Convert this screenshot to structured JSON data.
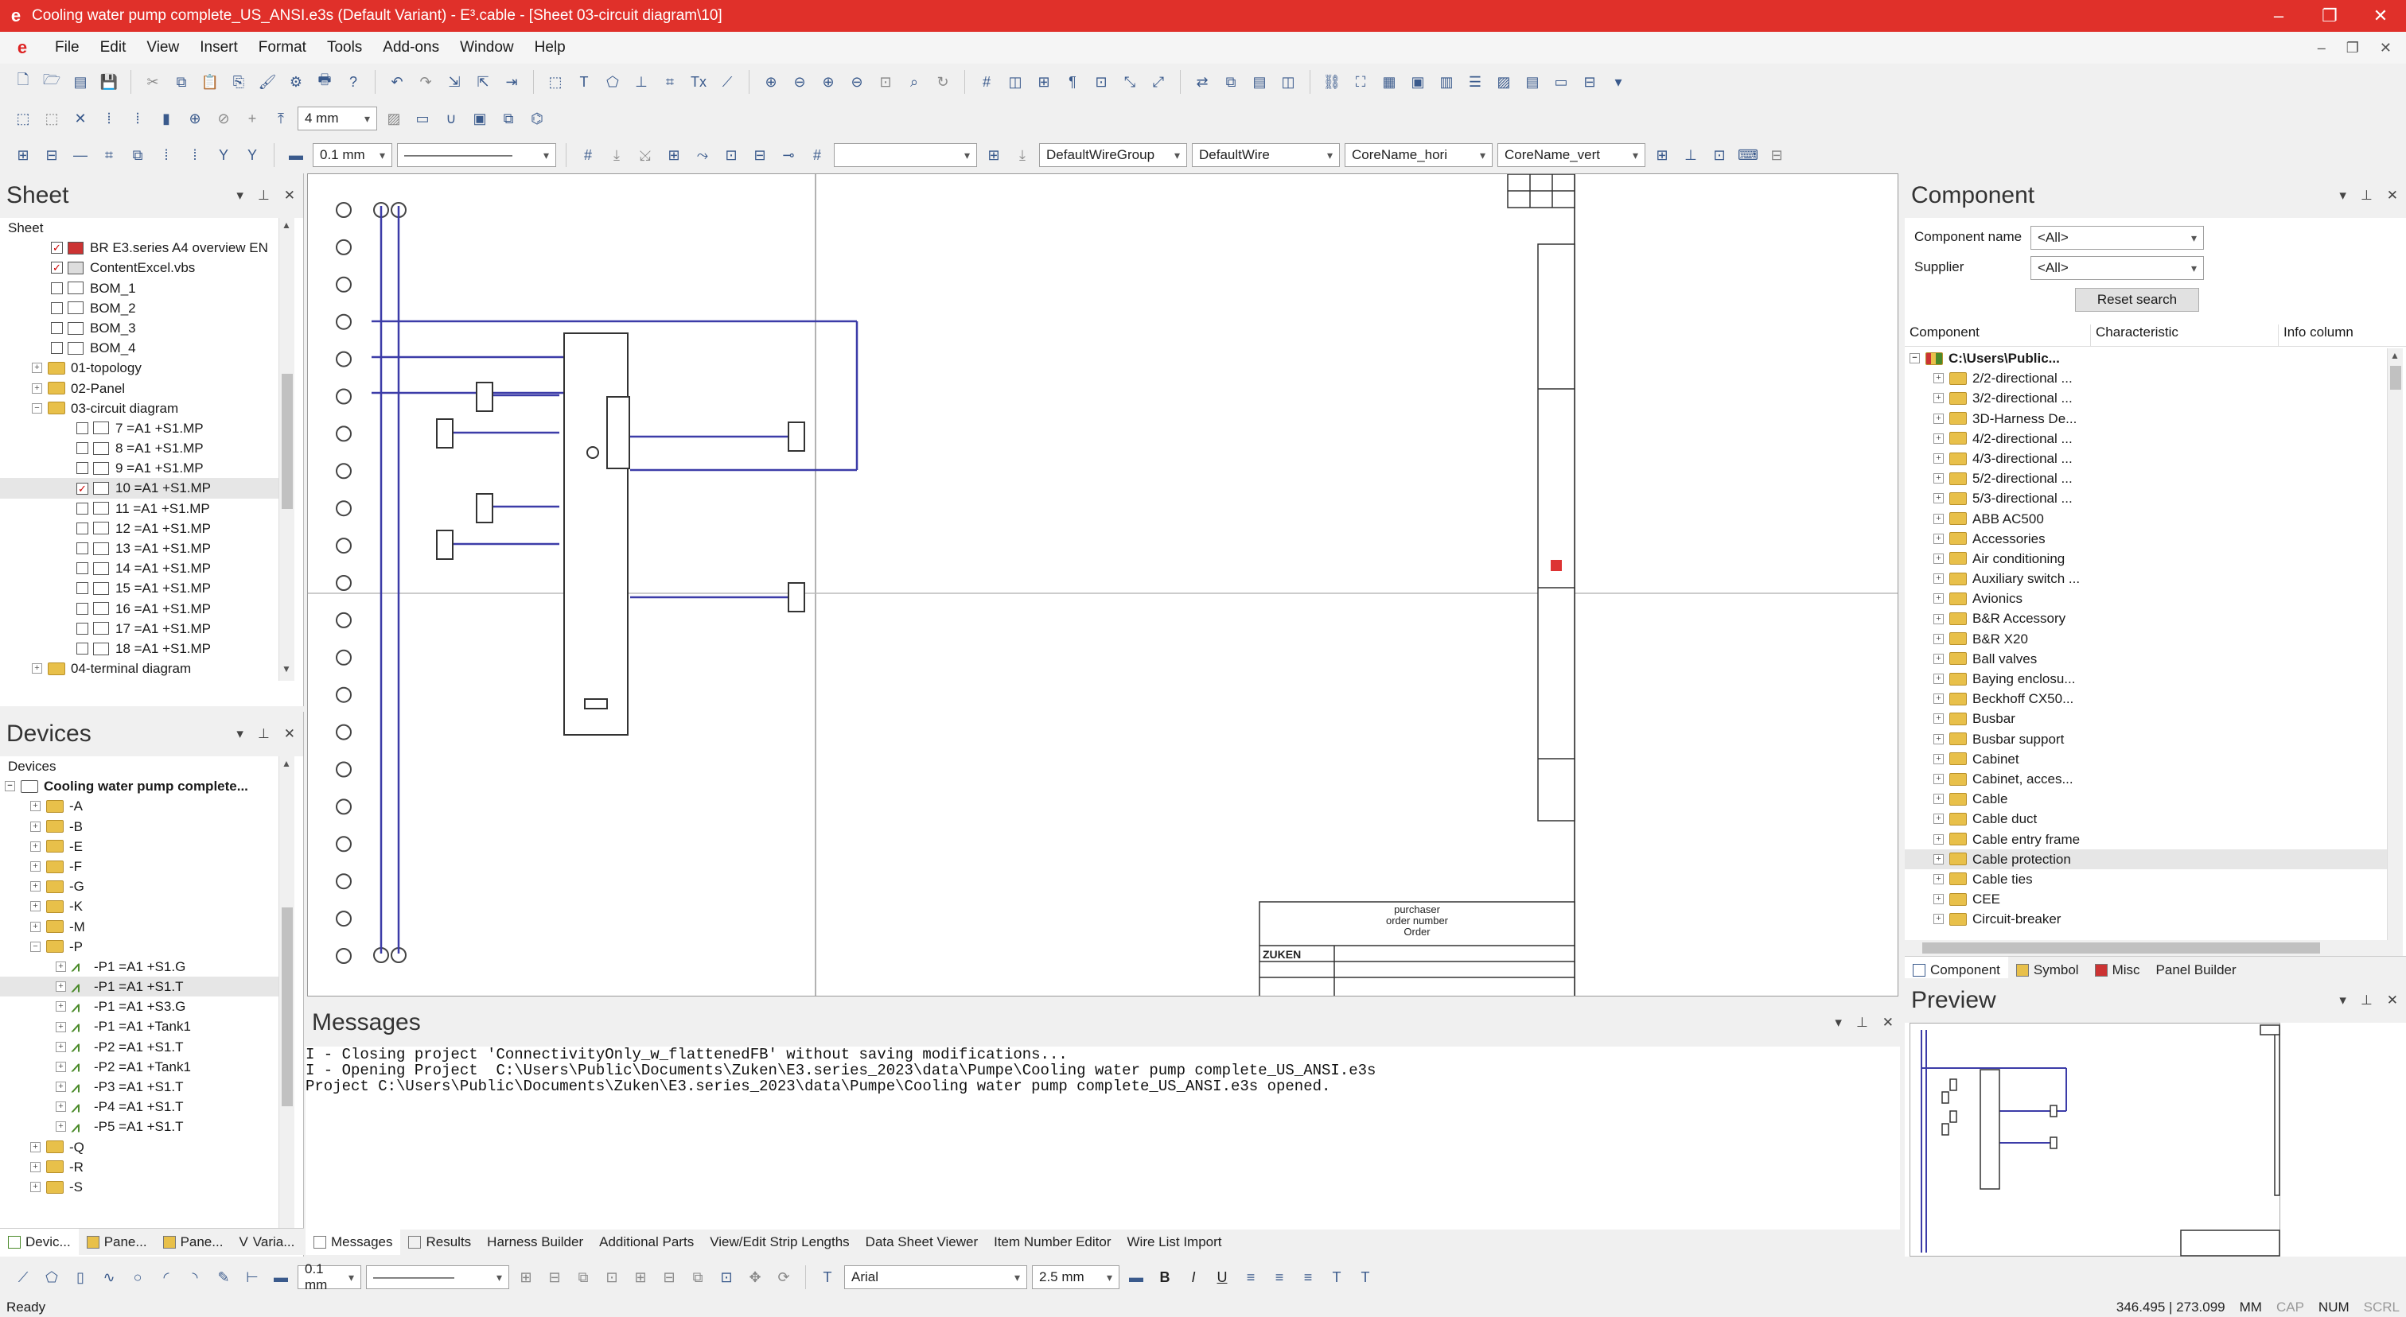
{
  "window": {
    "title": "Cooling water pump complete_US_ANSI.e3s (Default Variant) - E³.cable - [Sheet 03-circuit diagram\\10]",
    "controls": [
      "–",
      "❐",
      "✕"
    ]
  },
  "menu": [
    "File",
    "Edit",
    "View",
    "Insert",
    "Format",
    "Tools",
    "Add-ons",
    "Window",
    "Help"
  ],
  "toolbar": {
    "grid_size": "4 mm",
    "line_width": "0.1 mm",
    "wire_group": "DefaultWireGroup",
    "wire": "DefaultWire",
    "core_name_hori": "CoreName_hori",
    "core_name_vert": "CoreName_vert",
    "bottom_line_width": "0.1 mm",
    "font": "Arial",
    "font_size": "2.5 mm"
  },
  "sheet_panel": {
    "title": "Sheet",
    "header": "Sheet",
    "items": [
      {
        "label": "BR E3.series A4 overview EN",
        "kind": "pdf",
        "checked": true,
        "level": 2
      },
      {
        "label": "ContentExcel.vbs",
        "kind": "script",
        "checked": true,
        "level": 2
      },
      {
        "label": "BOM_1",
        "kind": "sheet",
        "checked": false,
        "level": 2
      },
      {
        "label": "BOM_2",
        "kind": "sheet",
        "checked": false,
        "level": 2
      },
      {
        "label": "BOM_3",
        "kind": "sheet",
        "checked": false,
        "level": 2
      },
      {
        "label": "BOM_4",
        "kind": "sheet",
        "checked": false,
        "level": 2
      },
      {
        "label": "01-topology",
        "kind": "folder",
        "expand": "+",
        "level": 1
      },
      {
        "label": "02-Panel",
        "kind": "folder",
        "expand": "+",
        "level": 1
      },
      {
        "label": "03-circuit diagram",
        "kind": "folder",
        "expand": "−",
        "level": 1
      },
      {
        "label": "7 =A1 +S1.MP",
        "kind": "sheet",
        "checked": false,
        "level": 3
      },
      {
        "label": "8 =A1 +S1.MP",
        "kind": "sheet",
        "checked": false,
        "level": 3
      },
      {
        "label": "9 =A1 +S1.MP",
        "kind": "sheet",
        "checked": false,
        "level": 3
      },
      {
        "label": "10 =A1 +S1.MP",
        "kind": "sheet",
        "checked": true,
        "selected": true,
        "level": 3
      },
      {
        "label": "11 =A1 +S1.MP",
        "kind": "sheet",
        "checked": false,
        "level": 3
      },
      {
        "label": "12 =A1 +S1.MP",
        "kind": "sheet",
        "checked": false,
        "level": 3
      },
      {
        "label": "13 =A1 +S1.MP",
        "kind": "sheet",
        "checked": false,
        "level": 3
      },
      {
        "label": "14 =A1 +S1.MP",
        "kind": "sheet",
        "checked": false,
        "level": 3
      },
      {
        "label": "15 =A1 +S1.MP",
        "kind": "sheet",
        "checked": false,
        "level": 3
      },
      {
        "label": "16 =A1 +S1.MP",
        "kind": "sheet",
        "checked": false,
        "level": 3
      },
      {
        "label": "17 =A1 +S1.MP",
        "kind": "sheet",
        "checked": false,
        "level": 3
      },
      {
        "label": "18 =A1 +S1.MP",
        "kind": "sheet",
        "checked": false,
        "level": 3
      },
      {
        "label": "04-terminal diagram",
        "kind": "folder",
        "expand": "+",
        "level": 1
      }
    ]
  },
  "devices_panel": {
    "title": "Devices",
    "header": "Devices",
    "items": [
      {
        "label": "Cooling water pump complete...",
        "kind": "root",
        "expand": "−",
        "level": 0
      },
      {
        "label": "-A",
        "kind": "folder",
        "expand": "+",
        "level": 1
      },
      {
        "label": "-B",
        "kind": "folder",
        "expand": "+",
        "level": 1
      },
      {
        "label": "-E",
        "kind": "folder",
        "expand": "+",
        "level": 1
      },
      {
        "label": "-F",
        "kind": "folder",
        "expand": "+",
        "level": 1
      },
      {
        "label": "-G",
        "kind": "folder",
        "expand": "+",
        "level": 1
      },
      {
        "label": "-K",
        "kind": "folder",
        "expand": "+",
        "level": 1
      },
      {
        "label": "-M",
        "kind": "folder",
        "expand": "+",
        "level": 1
      },
      {
        "label": "-P",
        "kind": "folder",
        "expand": "−",
        "level": 1
      },
      {
        "label": "-P1 =A1 +S1.G",
        "kind": "device",
        "expand": "+",
        "level": 2
      },
      {
        "label": "-P1 =A1 +S1.T",
        "kind": "device",
        "expand": "+",
        "level": 2,
        "selected": true
      },
      {
        "label": "-P1 =A1 +S3.G",
        "kind": "device",
        "expand": "+",
        "level": 2
      },
      {
        "label": "-P1 =A1 +Tank1",
        "kind": "device",
        "expand": "+",
        "level": 2
      },
      {
        "label": "-P2 =A1 +S1.T",
        "kind": "device",
        "expand": "+",
        "level": 2
      },
      {
        "label": "-P2 =A1 +Tank1",
        "kind": "device",
        "expand": "+",
        "level": 2
      },
      {
        "label": "-P3 =A1 +S1.T",
        "kind": "device",
        "expand": "+",
        "level": 2
      },
      {
        "label": "-P4 =A1 +S1.T",
        "kind": "device",
        "expand": "+",
        "level": 2
      },
      {
        "label": "-P5 =A1 +S1.T",
        "kind": "device",
        "expand": "+",
        "level": 2
      },
      {
        "label": "-Q",
        "kind": "folder",
        "expand": "+",
        "level": 1
      },
      {
        "label": "-R",
        "kind": "folder",
        "expand": "+",
        "level": 1
      },
      {
        "label": "-S",
        "kind": "folder",
        "expand": "+",
        "level": 1
      }
    ]
  },
  "left_tabs": [
    "Devic...",
    "Pane...",
    "Pane...",
    "Varia..."
  ],
  "messages": {
    "title": "Messages",
    "lines": [
      "I - Closing project 'ConnectivityOnly_w_flattenedFB' without saving modifications...",
      "I - Opening Project  C:\\Users\\Public\\Documents\\Zuken\\E3.series_2023\\data\\Pumpe\\Cooling water pump complete_US_ANSI.e3s",
      "Project C:\\Users\\Public\\Documents\\Zuken\\E3.series_2023\\data\\Pumpe\\Cooling water pump complete_US_ANSI.e3s opened."
    ],
    "tabs": [
      "Messages",
      "Results",
      "Harness Builder",
      "Additional Parts",
      "View/Edit Strip Lengths",
      "Data Sheet Viewer",
      "Item Number Editor",
      "Wire List Import"
    ]
  },
  "component_panel": {
    "title": "Component",
    "component_name_label": "Component name",
    "component_name_value": "<All>",
    "supplier_label": "Supplier",
    "supplier_value": "<All>",
    "reset_label": "Reset search",
    "columns": [
      "Component",
      "Characteristic",
      "Info column"
    ],
    "root": "C:\\Users\\Public...",
    "items": [
      "2/2-directional ...",
      "3/2-directional ...",
      "3D-Harness De...",
      "4/2-directional ...",
      "4/3-directional ...",
      "5/2-directional ...",
      "5/3-directional ...",
      "ABB AC500",
      "Accessories",
      "Air conditioning",
      "Auxiliary switch ...",
      "Avionics",
      "B&R Accessory",
      "B&R X20",
      "Ball valves",
      "Baying enclosu...",
      "Beckhoff CX50...",
      "Busbar",
      "Busbar support",
      "Cabinet",
      "Cabinet, acces...",
      "Cable",
      "Cable duct",
      "Cable entry frame",
      "Cable protection",
      "Cable ties",
      "CEE",
      "Circuit-breaker"
    ],
    "selected_item": "Cable protection",
    "tabs": [
      "Component",
      "Symbol",
      "Misc",
      "Panel Builder"
    ]
  },
  "preview_panel": {
    "title": "Preview"
  },
  "title_block": {
    "purchaser": "purchaser",
    "order_number": "order number",
    "order": "Order",
    "company": "ZUKEN"
  },
  "status": {
    "left": "Ready",
    "coords": "346.495 | 273.099",
    "unit": "MM",
    "caps": "CAP",
    "num": "NUM",
    "scrl": "SCRL"
  },
  "colors": {
    "titlebar": "#e0302a",
    "wire": "#3c3ca8",
    "accent": "#3a5a8c"
  }
}
